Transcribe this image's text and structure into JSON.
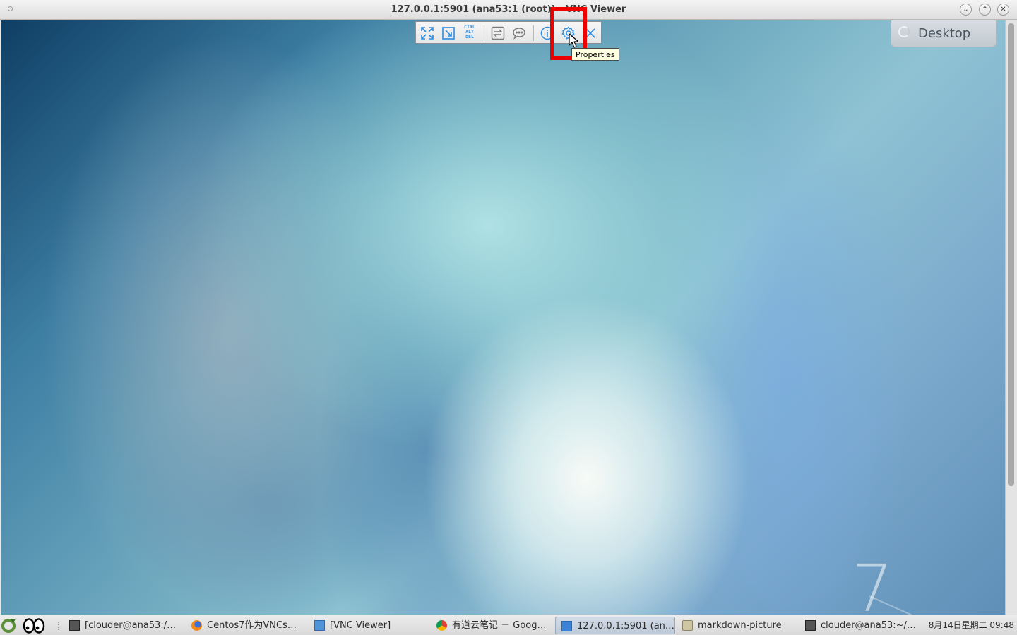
{
  "window": {
    "title": "127.0.0.1:5901 (ana53:1 (root)) - VNC Viewer",
    "minimize_glyph": "⌄",
    "maximize_glyph": "⌃",
    "close_glyph": "✕"
  },
  "vnc_toolbar": {
    "buttons": [
      {
        "name": "fullscreen",
        "icon": "expand-arrows-icon"
      },
      {
        "name": "scaling",
        "icon": "scale-to-window-icon"
      },
      {
        "name": "ctrl-alt-del",
        "icon": "ctrl-alt-del-icon"
      },
      {
        "name": "file-transfer",
        "icon": "transfer-arrows-icon"
      },
      {
        "name": "chat",
        "icon": "chat-bubble-icon"
      },
      {
        "name": "information",
        "icon": "info-icon"
      },
      {
        "name": "properties",
        "icon": "gear-icon"
      },
      {
        "name": "close-connection",
        "icon": "close-x-icon"
      }
    ],
    "cad_lines": [
      "CTRL",
      "ALT",
      "DEL"
    ],
    "tooltip": "Properties",
    "accent_color": "#2f8de0",
    "highlight_color": "#ee0000"
  },
  "remote_desktop": {
    "switcher_label": "Desktop",
    "watermark": "7"
  },
  "taskbar": {
    "items": [
      {
        "label": "[clouder@ana53:/…",
        "icon": "terminal-icon"
      },
      {
        "label": "Centos7作为VNCs…",
        "icon": "firefox-icon"
      },
      {
        "label": "[VNC Viewer]",
        "icon": "vnc-icon"
      },
      {
        "label": "有道云笔记 － Goog…",
        "icon": "chrome-icon"
      },
      {
        "label": "127.0.0.1:5901 (an…",
        "icon": "vnc-icon",
        "active": true
      },
      {
        "label": "markdown-picture",
        "icon": "folder-icon"
      },
      {
        "label": "clouder@ana53:~/…",
        "icon": "terminal-icon"
      }
    ],
    "clock": "8月14日星期二 09:48"
  }
}
